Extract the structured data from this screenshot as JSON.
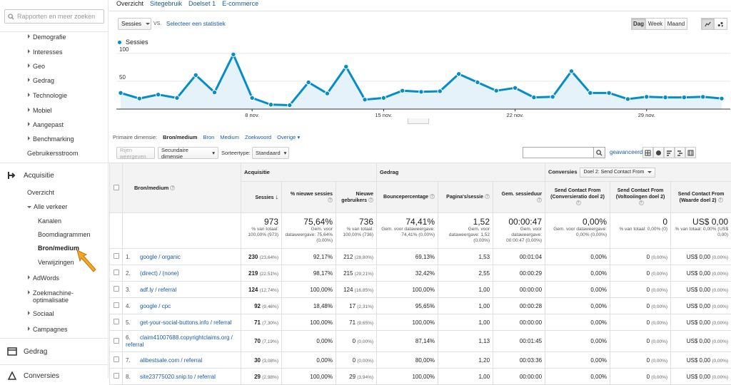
{
  "sidebar": {
    "search_placeholder": "Rapporten en meer zoeken",
    "items": [
      {
        "label": "Demografie"
      },
      {
        "label": "Interesses"
      },
      {
        "label": "Geo"
      },
      {
        "label": "Gedrag"
      },
      {
        "label": "Technologie"
      },
      {
        "label": "Mobiel"
      },
      {
        "label": "Aangepast"
      },
      {
        "label": "Benchmarking"
      }
    ],
    "gebruikersstroom": "Gebruikersstroom",
    "acquisitie": "Acquisitie",
    "overzicht": "Overzicht",
    "alle_verkeer": "Alle verkeer",
    "sub": [
      "Kanalen",
      "Boomdiagrammen",
      "Bron/medium",
      "Verwijzingen"
    ],
    "more": [
      "AdWords",
      "Zoekmachine-",
      "optimalisatie",
      "Sociaal",
      "Campagnes"
    ],
    "gedrag": "Gedrag",
    "conversies": "Conversies"
  },
  "tabs": [
    "Overzicht",
    "Sitegebruik",
    "Doelset 1",
    "E-commerce"
  ],
  "controls": {
    "metric": "Sessies",
    "vs": "VS.",
    "select_stat": "Selecteer een statistiek",
    "periods": [
      "Dag",
      "Week",
      "Maand"
    ]
  },
  "chart_data": {
    "type": "line",
    "series": [
      {
        "name": "Sessies",
        "values": [
          29,
          19,
          26,
          20,
          61,
          30,
          98,
          20,
          8,
          7,
          48,
          28,
          76,
          17,
          20,
          33,
          31,
          32,
          63,
          48,
          33,
          38,
          21,
          22,
          68,
          29,
          29,
          18,
          22,
          21,
          21,
          22,
          19
        ]
      }
    ],
    "x_ticks": [
      "8 nov.",
      "15 nov.",
      "22 nov.",
      "29 nov."
    ],
    "y_ticks": [
      "100",
      "50"
    ],
    "ylim": [
      0,
      110
    ],
    "color": "#058dc7"
  },
  "dimensions": {
    "label": "Primaire dimensie:",
    "current": "Bron/medium",
    "links": [
      "Bron",
      "Medium",
      "Zoekwoord",
      "Overige"
    ]
  },
  "toolbar": {
    "rijen": "Rijen weergeven",
    "secondary": "Secundaire dimensie",
    "sorttype_label": "Sorteertype:",
    "sorttype": "Standaard",
    "advanced": "geavanceerd"
  },
  "table": {
    "dim_header": "Bron/medium",
    "groups": {
      "acq": "Acquisitie",
      "behav": "Gedrag",
      "conv": "Conversies",
      "goal": "Doel 2: Send Contact From"
    },
    "cols": [
      "Sessies",
      "% nieuwe sessies",
      "Nieuwe gebruikers",
      "Bouncepercentage",
      "Pagina's/sessie",
      "Gem. sessieduur",
      "Send Contact From (Conversieratio doel 2)",
      "Send Contact From (Voltooiingen doel 2)",
      "Send Contact From (Waarde doel 2)"
    ],
    "totals": [
      {
        "big": "973",
        "sm": "% van totaal: 100,00% (973)"
      },
      {
        "big": "75,64%",
        "sm": "Gem. voor dataweergave: 75,64% (0,00%)"
      },
      {
        "big": "736",
        "sm": "% van totaal: 100,00% (736)"
      },
      {
        "big": "74,41%",
        "sm": "Gem. voor dataweergave: 74,41% (0,00%)"
      },
      {
        "big": "1,52",
        "sm": "Gem. voor dataweergave: 1,52 (0,00%)"
      },
      {
        "big": "00:00:47",
        "sm": "Gem. voor dataweergave: 00:00:47 (0,00%)"
      },
      {
        "big": "0,00%",
        "sm": "Gem. voor dataweergave: 0,00% (0,00%)"
      },
      {
        "big": "0",
        "sm": "% van totaal: 0,00% (0)"
      },
      {
        "big": "US$ 0,00",
        "sm": "% van totaal: 0,00% (US$ 0,00)"
      }
    ],
    "rows": [
      {
        "n": "1.",
        "src": "google / organic",
        "s": "230",
        "sp": "(23,64%)",
        "ns": "92,17%",
        "nu": "212",
        "nup": "(28,80%)",
        "b": "69,13%",
        "p": "1,53",
        "d": "00:01:04",
        "cr": "0,00%",
        "cv": "0",
        "cvp": "(0,00%)",
        "val": "US$ 0,00",
        "valp": "(0,00%)"
      },
      {
        "n": "2.",
        "src": "(direct) / (none)",
        "s": "219",
        "sp": "(22,51%)",
        "ns": "98,17%",
        "nu": "215",
        "nup": "(29,21%)",
        "b": "32,42%",
        "p": "2,55",
        "d": "00:00:29",
        "cr": "0,00%",
        "cv": "0",
        "cvp": "(0,00%)",
        "val": "US$ 0,00",
        "valp": "(0,00%)"
      },
      {
        "n": "3.",
        "src": "adf.ly / referral",
        "s": "124",
        "sp": "(12,74%)",
        "ns": "100,00%",
        "nu": "124",
        "nup": "(16,85%)",
        "b": "100,00%",
        "p": "1,00",
        "d": "00:00:00",
        "cr": "0,00%",
        "cv": "0",
        "cvp": "(0,00%)",
        "val": "US$ 0,00",
        "valp": "(0,00%)"
      },
      {
        "n": "4.",
        "src": "google / cpc",
        "s": "92",
        "sp": "(9,46%)",
        "ns": "18,48%",
        "nu": "17",
        "nup": "(2,31%)",
        "b": "95,65%",
        "p": "1,00",
        "d": "00:00:28",
        "cr": "0,00%",
        "cv": "0",
        "cvp": "(0,00%)",
        "val": "US$ 0,00",
        "valp": "(0,00%)"
      },
      {
        "n": "5.",
        "src": "get-your-social-buttons.info / referral",
        "s": "71",
        "sp": "(7,30%)",
        "ns": "100,00%",
        "nu": "71",
        "nup": "(9,65%)",
        "b": "100,00%",
        "p": "1,00",
        "d": "00:00:00",
        "cr": "0,00%",
        "cv": "0",
        "cvp": "(0,00%)",
        "val": "US$ 0,00",
        "valp": "(0,00%)"
      },
      {
        "n": "6.",
        "src": "claim41007688.copyrightclaims.org / referral",
        "s": "70",
        "sp": "(7,19%)",
        "ns": "0,00%",
        "nu": "0",
        "nup": "(0,00%)",
        "b": "87,14%",
        "p": "1,13",
        "d": "00:01:45",
        "cr": "0,00%",
        "cv": "0",
        "cvp": "(0,00%)",
        "val": "US$ 0,00",
        "valp": "(0,00%)"
      },
      {
        "n": "7.",
        "src": "alibestsale.com / referral",
        "s": "30",
        "sp": "(3,08%)",
        "ns": "0,00%",
        "nu": "0",
        "nup": "(0,00%)",
        "b": "80,00%",
        "p": "1,20",
        "d": "00:03:36",
        "cr": "0,00%",
        "cv": "0",
        "cvp": "(0,00%)",
        "val": "US$ 0,00",
        "valp": "(0,00%)"
      },
      {
        "n": "8.",
        "src": "site23775020.snip.to / referral",
        "s": "29",
        "sp": "(2,98%)",
        "ns": "100,00%",
        "nu": "29",
        "nup": "(3,94%)",
        "b": "100,00%",
        "p": "1,00",
        "d": "00:00:00",
        "cr": "0,00%",
        "cv": "0",
        "cvp": "(0,00%)",
        "val": "US$ 0,00",
        "valp": "(0,00%)"
      }
    ]
  }
}
